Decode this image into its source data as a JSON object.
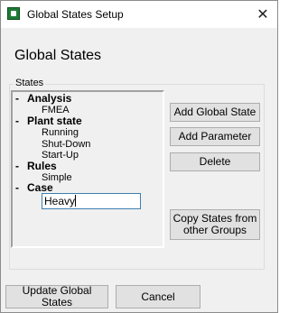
{
  "window": {
    "title": "Global States Setup",
    "close_glyph": "✕"
  },
  "heading": "Global States",
  "group": {
    "label": "States",
    "tree": [
      {
        "category": "Analysis",
        "items": [
          "FMEA"
        ]
      },
      {
        "category": "Plant state",
        "items": [
          "Running",
          "Shut-Down",
          "Start-Up"
        ]
      },
      {
        "category": "Rules",
        "items": [
          "Simple"
        ]
      },
      {
        "category": "Case",
        "edit_value": "Heavy"
      }
    ],
    "collapse_glyph": "-"
  },
  "buttons": {
    "add_global_state": "Add Global State",
    "add_parameter": "Add Parameter",
    "delete": "Delete",
    "copy_states_line1": "Copy States from",
    "copy_states_line2": "other Groups",
    "update": "Update Global States",
    "cancel": "Cancel"
  },
  "icons": {
    "app": "app-logo-icon",
    "close": "close-icon"
  },
  "colors": {
    "edit_border": "#3c7fb1",
    "app_icon": "#1e7b34"
  }
}
